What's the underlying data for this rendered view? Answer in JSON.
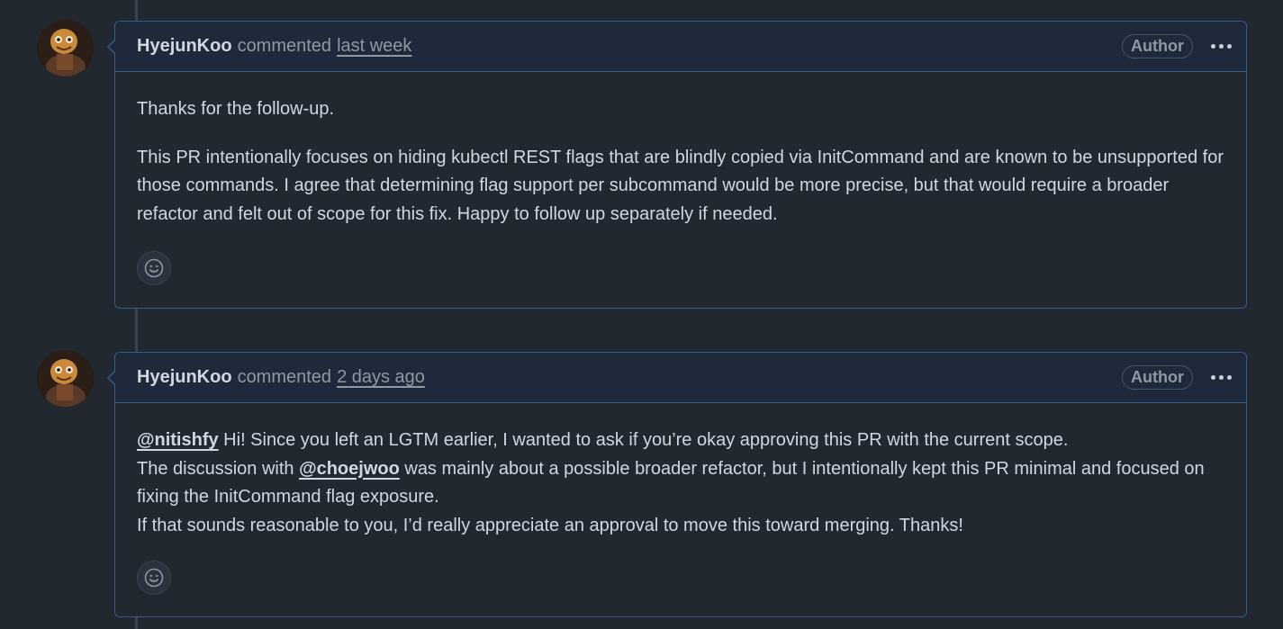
{
  "comments": [
    {
      "author": "HyejunKoo",
      "action": "commented",
      "timestamp": "last week",
      "badge": "Author",
      "paragraphs": [
        "Thanks for the follow-up.",
        "This PR intentionally focuses on hiding kubectl REST flags that are blindly copied via InitCommand and are known to be unsupported for those commands. I agree that determining flag support per subcommand would be more precise, but that would require a broader refactor and felt out of scope for this fix. Happy to follow up separately if needed."
      ],
      "reaction_icon": "smiley-icon",
      "more_icon": "kebab-horizontal-icon"
    },
    {
      "author": "HyejunKoo",
      "action": "commented",
      "timestamp": "2 days ago",
      "badge": "Author",
      "mention1": "@nitishfy",
      "line1_rest": " Hi! Since you left an LGTM earlier, I wanted to ask if you’re okay approving this PR with the current scope.",
      "line2_pre": "The discussion with ",
      "mention2": "@choejwoo",
      "line2_rest": " was mainly about a possible broader refactor, but I intentionally kept this PR minimal and focused on fixing the InitCommand flag exposure.",
      "line3": "If that sounds reasonable to you, I’d really appreciate an approval to move this toward merging. Thanks!",
      "reaction_icon": "smiley-icon",
      "more_icon": "kebab-horizontal-icon"
    }
  ],
  "colors": {
    "background": "#212830",
    "header_bg": "#1e2a3c",
    "border": "#3a5a8a",
    "text": "#d1d7e0",
    "muted": "#9198a1"
  }
}
